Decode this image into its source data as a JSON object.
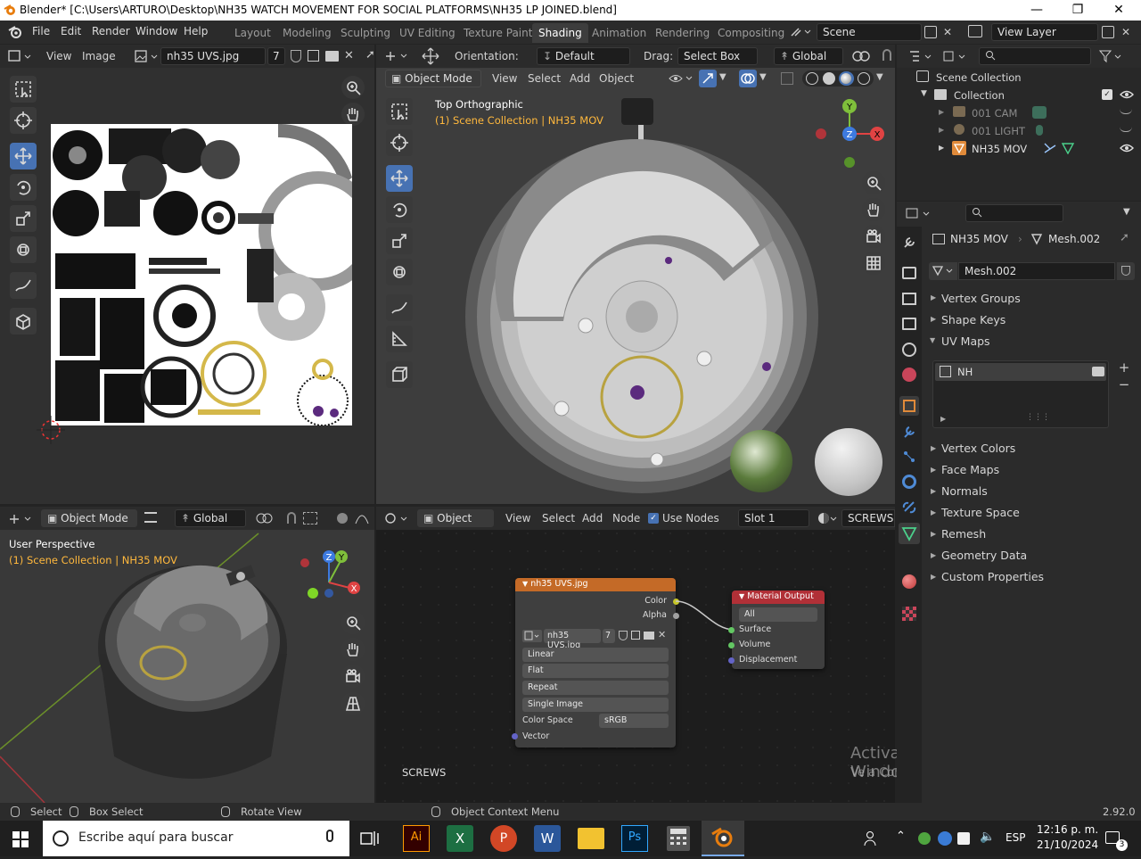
{
  "window": {
    "title": "Blender* [C:\\Users\\ARTURO\\Desktop\\NH35 WATCH MOVEMENT FOR SOCIAL PLATFORMS\\NH35 LP JOINED.blend]"
  },
  "menu": [
    "File",
    "Edit",
    "Render",
    "Window",
    "Help"
  ],
  "workspaces": [
    "Layout",
    "Modeling",
    "Sculpting",
    "UV Editing",
    "Texture Paint",
    "Shading",
    "Animation",
    "Rendering",
    "Compositing"
  ],
  "active_workspace": "Shading",
  "scene": "Scene",
  "view_layer": "View Layer",
  "image_editor": {
    "view": "View",
    "image": "Image",
    "image_name": "nh35 UVS.jpg",
    "users": "7"
  },
  "viewport_top": {
    "orientation_label": "Orientation:",
    "orientation": "Default",
    "drag_label": "Drag:",
    "drag": "Select Box",
    "transform": "Global",
    "mode": "Object Mode",
    "menus": [
      "View",
      "Select",
      "Add",
      "Object"
    ],
    "view_name": "Top Orthographic",
    "collection_info": "(1) Scene Collection | NH35 MOV",
    "gizmo": {
      "x": "X",
      "y": "Y",
      "z": "Z"
    }
  },
  "viewport_bottom": {
    "mode": "Object Mode",
    "transform": "Global",
    "view_name": "User Perspective",
    "collection_info": "(1) Scene Collection | NH35 MOV",
    "gizmo": {
      "x": "X",
      "y": "Y",
      "z": "Z"
    }
  },
  "outliner": {
    "root": "Scene Collection",
    "collection": "Collection",
    "items": [
      {
        "name": "001 CAM",
        "dim": true
      },
      {
        "name": "001 LIGHT",
        "dim": true
      },
      {
        "name": "NH35 MOV",
        "dim": false
      }
    ]
  },
  "properties": {
    "object": "NH35 MOV",
    "mesh": "Mesh.002",
    "mesh_field": "Mesh.002",
    "panels_top": [
      "Vertex Groups",
      "Shape Keys",
      "UV Maps"
    ],
    "uv_map": "NH",
    "panels_bottom": [
      "Vertex Colors",
      "Face Maps",
      "Normals",
      "Texture Space",
      "Remesh",
      "Geometry Data",
      "Custom Properties"
    ]
  },
  "node_editor": {
    "object": "Object",
    "menus": [
      "View",
      "Select",
      "Add",
      "Node"
    ],
    "use_nodes": "Use Nodes",
    "slot": "Slot 1",
    "material": "SCREWS",
    "footer_label": "SCREWS",
    "image_node": {
      "title": "nh35 UVS.jpg",
      "out_color": "Color",
      "out_alpha": "Alpha",
      "image": "nh35 UVS.jpg",
      "users": "7",
      "interpolation": "Linear",
      "projection": "Flat",
      "extension": "Repeat",
      "source": "Single Image",
      "colorspace_label": "Color Space",
      "colorspace": "sRGB",
      "in_vector": "Vector"
    },
    "output_node": {
      "title": "Material Output",
      "target": "All",
      "in_surface": "Surface",
      "in_volume": "Volume",
      "in_displacement": "Displacement"
    }
  },
  "watermark": {
    "line1": "Activar Windows",
    "line2": "Ve a Configuración para activar Windows."
  },
  "statusbar": {
    "select": "Select",
    "box_select": "Box Select",
    "rotate": "Rotate View",
    "context": "Object Context Menu",
    "version": "2.92.0"
  },
  "taskbar": {
    "search": "Escribe aquí para buscar",
    "lang": "ESP",
    "time": "12:16 p. m.",
    "date": "21/10/2024",
    "notifications": "3"
  },
  "colors": {
    "accent": "#4772b3",
    "selected": "#ffb83d",
    "image_node_header": "#c46a27",
    "output_node_header": "#b13037"
  }
}
